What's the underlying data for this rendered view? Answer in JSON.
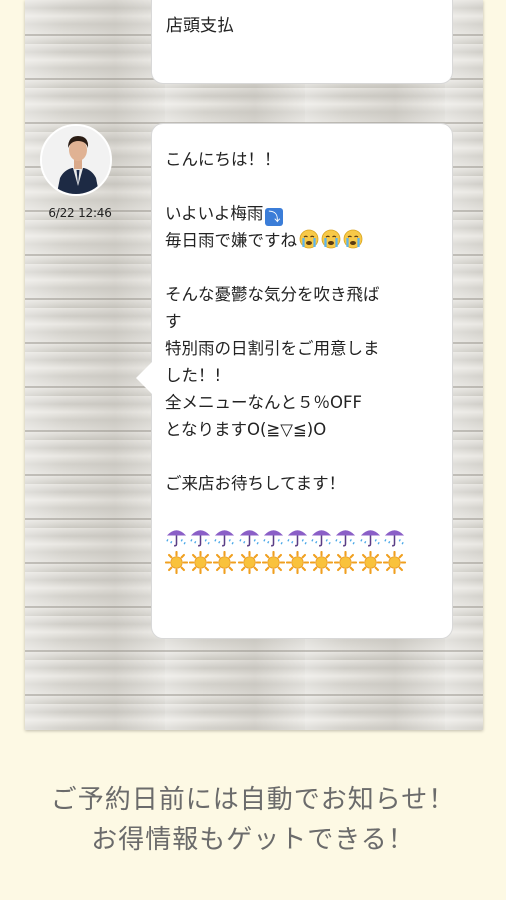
{
  "top_bubble": {
    "text": "店頭支払"
  },
  "message": {
    "timestamp": "6/22 12:46",
    "lines": [
      "こんにちは！！",
      "",
      "いよいよ梅雨",
      "毎日雨で嫌ですね",
      "",
      "そんな憂鬱な気分を吹き飛ば",
      "す",
      "特別雨の日割引をご用意しま",
      "した！!",
      "全メニューなんと５％OFF",
      "となりますO(≧▽≦)O",
      "",
      "ご来店お待ちしてます！"
    ],
    "badge_glyph": "⤵",
    "crying_emoji_count": 3,
    "umbrella_emoji_count": 10,
    "sun_emoji_count": 10
  },
  "caption": {
    "line1": "ご予約日前には自動でお知らせ！",
    "line2": "お得情報もゲットできる！"
  },
  "colors": {
    "background": "#fdf9e4",
    "caption_text": "#6b6b6b",
    "bubble": "#ffffff",
    "badge": "#3b7dd8"
  }
}
